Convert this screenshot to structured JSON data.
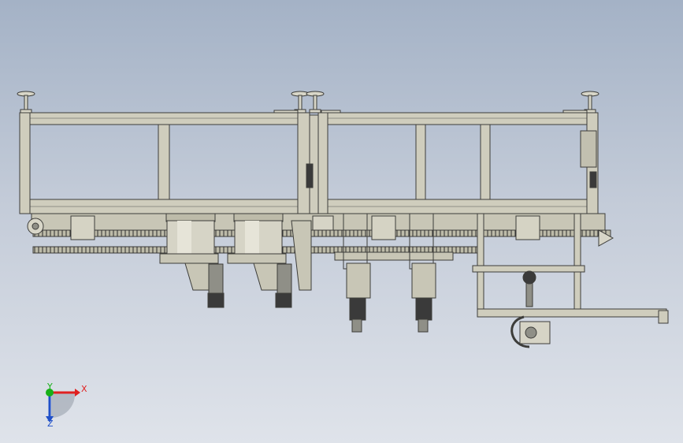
{
  "viewport": {
    "background_top": "#a4b2c6",
    "background_bottom": "#dfe3ea"
  },
  "model": {
    "frame_color": "#cfcdbd",
    "edge_color": "#3d3d3a",
    "detail_color": "#8f8f87",
    "dark_color": "#2d2d2d"
  },
  "triad": {
    "x_label": "X",
    "y_label": "Y",
    "z_label": "Z",
    "x_color": "#e02020",
    "y_color": "#18b018",
    "z_color": "#2050c8"
  }
}
